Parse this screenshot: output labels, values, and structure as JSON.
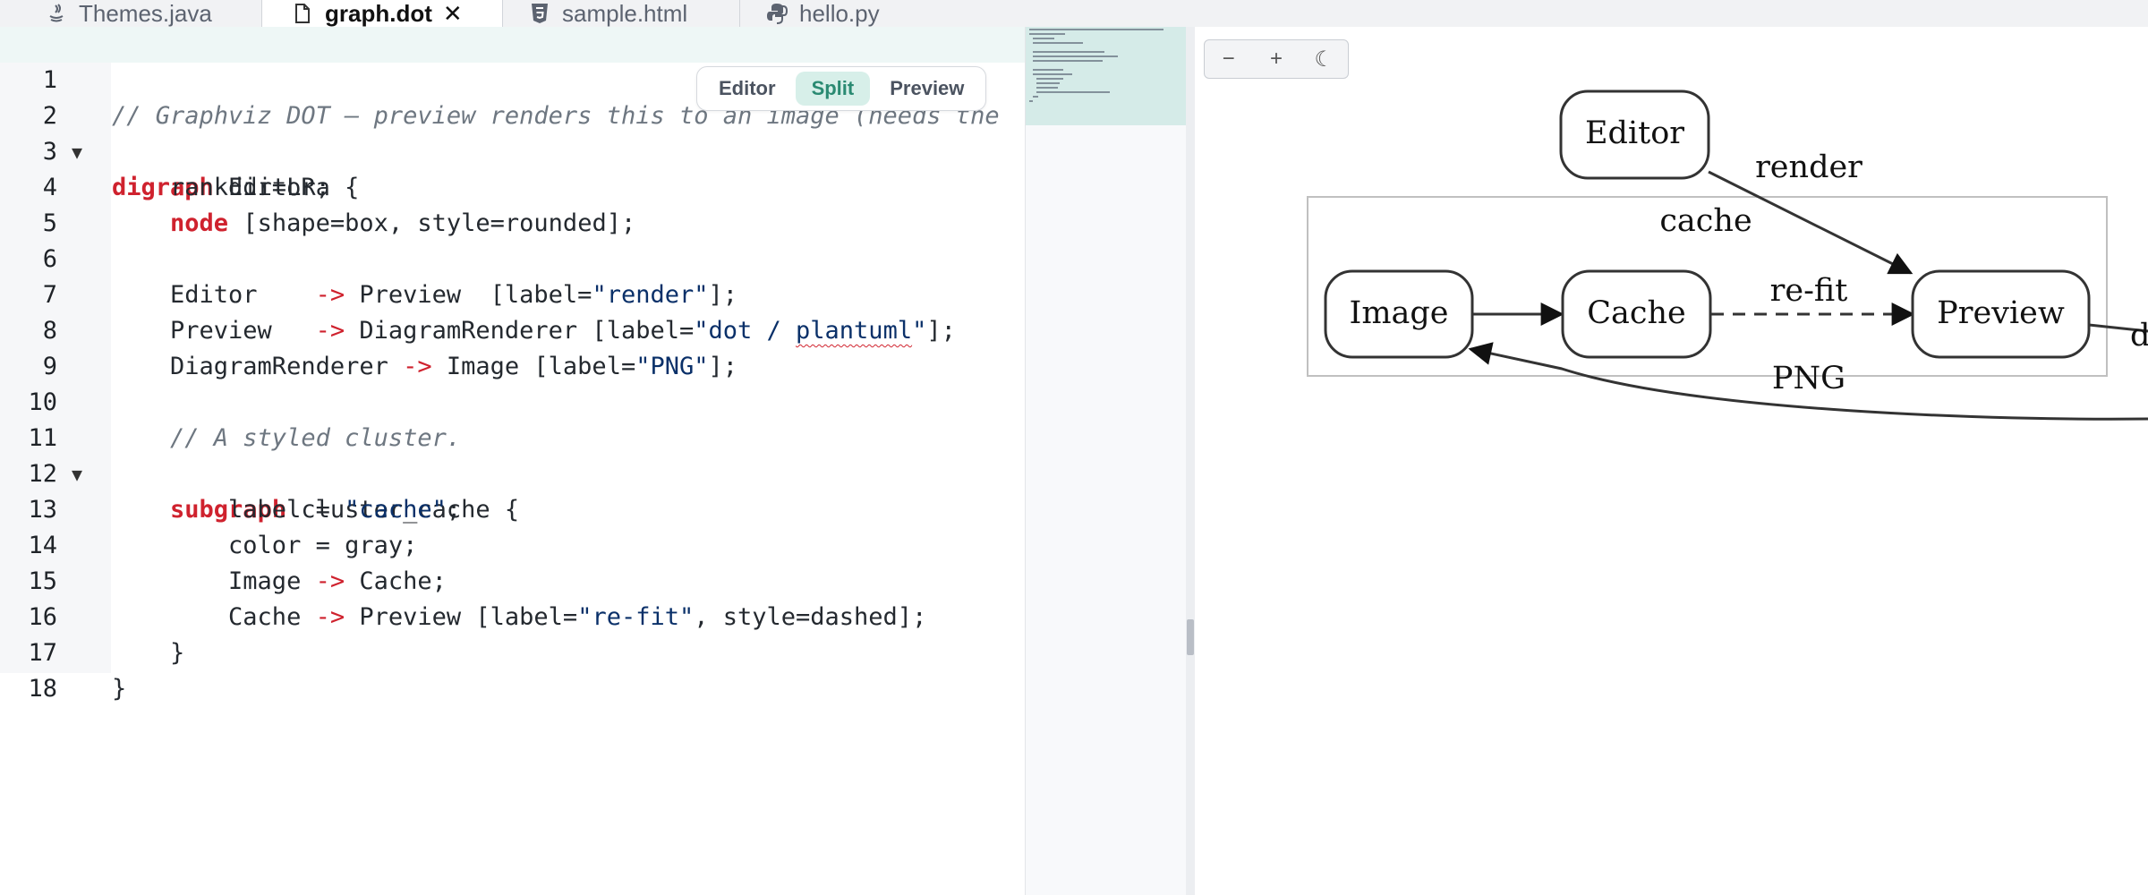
{
  "tabs": [
    {
      "label": "Themes.java",
      "icon": "java-icon",
      "active": false
    },
    {
      "label": "graph.dot",
      "icon": "file-icon",
      "active": true,
      "close": "✕"
    },
    {
      "label": "sample.html",
      "icon": "html5-icon",
      "active": false
    },
    {
      "label": "hello.py",
      "icon": "python-icon",
      "active": false
    }
  ],
  "view_toggle": {
    "editor": "Editor",
    "split": "Split",
    "preview": "Preview",
    "selected": "Split"
  },
  "editor": {
    "line_numbers": [
      "1",
      "2",
      "3",
      "4",
      "5",
      "6",
      "7",
      "8",
      "9",
      "10",
      "11",
      "12",
      "13",
      "14",
      "15",
      "16",
      "17",
      "18"
    ],
    "fold_marker": "▼",
    "line1": {
      "comment": "// Graphviz DOT — preview renders this to an image (needs the"
    },
    "line2": {
      "kw": "digraph",
      "rest": " Editora {"
    },
    "line3": {
      "text": "    rankdir=LR;"
    },
    "line4": {
      "indent": "    ",
      "kw": "node",
      "rest": " [shape=box, style=rounded];"
    },
    "line6": {
      "a": "    Editor    ",
      "arrow": "->",
      "b": " Preview  [label=",
      "str": "\"render\"",
      "c": "];"
    },
    "line7": {
      "a": "    Preview   ",
      "arrow": "->",
      "b": " DiagramRenderer [label=",
      "str1": "\"dot / ",
      "str2": "plantuml",
      "str3": "\"",
      "c": "];"
    },
    "line8": {
      "a": "    DiagramRenderer ",
      "arrow": "->",
      "b": " Image [label=",
      "str": "\"PNG\"",
      "c": "];"
    },
    "line10": {
      "comment": "    // A styled cluster."
    },
    "line11": {
      "indent": "    ",
      "kw": "subgraph",
      "rest": " cluster_cache {"
    },
    "line12": {
      "a": "        label = ",
      "str": "\"cache\"",
      "c": ";"
    },
    "line13": {
      "text": "        color = gray;"
    },
    "line14": {
      "a": "        Image ",
      "arrow": "->",
      "b": " Cache;"
    },
    "line15": {
      "a": "        Cache ",
      "arrow": "->",
      "b": " Preview [label=",
      "str": "\"re-fit\"",
      "c": ", style=dashed];"
    },
    "line16": {
      "text": "    }"
    },
    "line17": {
      "text": "}"
    }
  },
  "preview": {
    "zoom_out": "−",
    "zoom_in": "+",
    "theme_icon": "☾",
    "graph": {
      "cluster_label": "cache",
      "nodes": {
        "editor": "Editor",
        "image": "Image",
        "cache": "Cache",
        "preview": "Preview",
        "clipped": "d"
      },
      "edge_labels": {
        "render": "render",
        "refit": "re-fit",
        "png": "PNG"
      }
    }
  },
  "colors": {
    "accent": "#2a8a72",
    "keyword": "#cf222e",
    "string": "#0a3069",
    "comment": "#6e7781",
    "cluster_border": "#c0c0c0"
  }
}
